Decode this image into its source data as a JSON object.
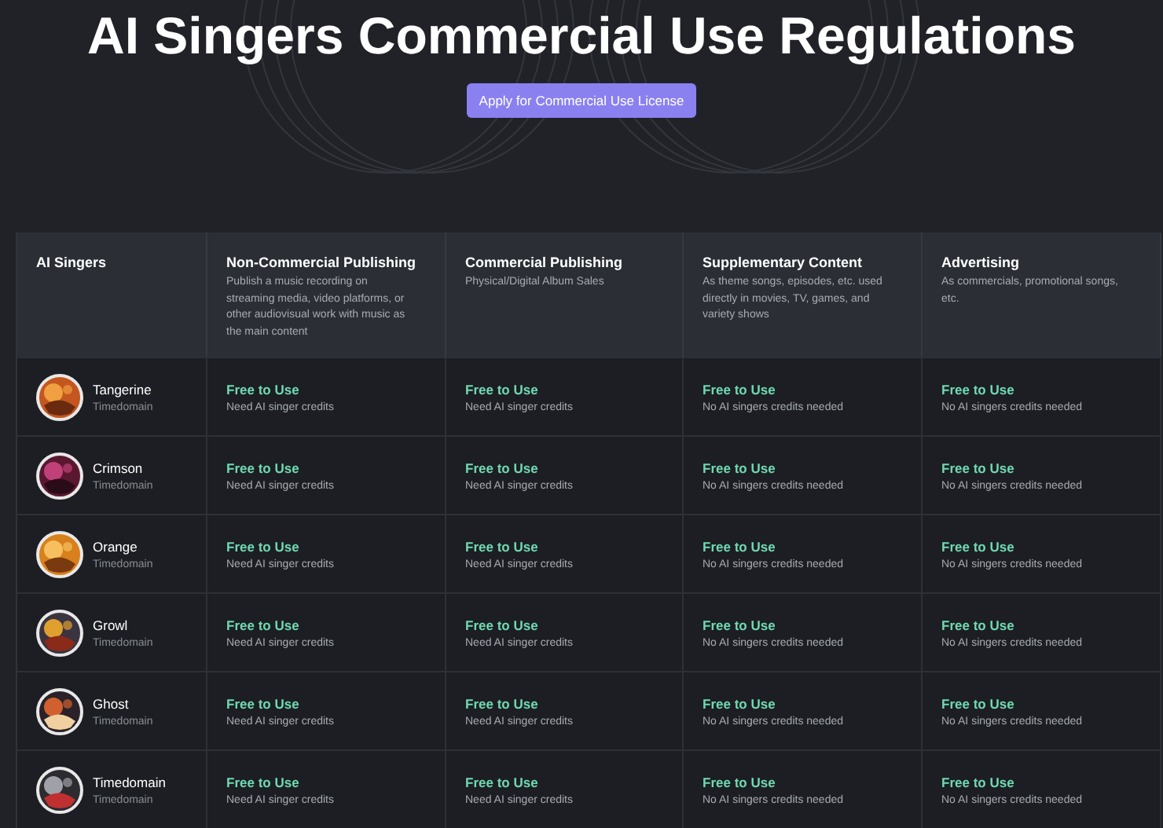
{
  "title": "AI Singers Commercial Use Regulations",
  "apply_button": "Apply for Commercial Use License",
  "table": {
    "columns": [
      {
        "title": "AI Singers"
      },
      {
        "title": "Non-Commercial Publishing",
        "description": "Publish a music recording on streaming media, video platforms, or other audiovisual work with music as the main content"
      },
      {
        "title": "Commercial Publishing",
        "description": "Physical/Digital Album Sales"
      },
      {
        "title": "Supplementary Content",
        "description": "As theme songs, episodes, etc. used directly in movies, TV, games, and variety shows"
      },
      {
        "title": "Advertising",
        "description": "As commercials, promotional songs, etc."
      }
    ],
    "rows": [
      {
        "cells": [
          {
            "name": "Tangerine",
            "maker": "Timedomain"
          },
          {
            "status": "Free to Use",
            "note": "Need AI singer credits"
          },
          {
            "status": "Free to Use",
            "note": "Need AI singer credits"
          },
          {
            "status": "Free to Use",
            "note": "No AI singers credits needed"
          },
          {
            "status": "Free to Use",
            "note": "No AI singers credits needed"
          }
        ]
      },
      {
        "cells": [
          {
            "name": "Crimson",
            "maker": "Timedomain"
          },
          {
            "status": "Free to Use",
            "note": "Need AI singer credits"
          },
          {
            "status": "Free to Use",
            "note": "Need AI singer credits"
          },
          {
            "status": "Free to Use",
            "note": "No AI singers credits needed"
          },
          {
            "status": "Free to Use",
            "note": "No AI singers credits needed"
          }
        ]
      },
      {
        "cells": [
          {
            "name": "Orange",
            "maker": "Timedomain"
          },
          {
            "status": "Free to Use",
            "note": "Need AI singer credits"
          },
          {
            "status": "Free to Use",
            "note": "Need AI singer credits"
          },
          {
            "status": "Free to Use",
            "note": "No AI singers credits needed"
          },
          {
            "status": "Free to Use",
            "note": "No AI singers credits needed"
          }
        ]
      },
      {
        "cells": [
          {
            "name": "Growl",
            "maker": "Timedomain"
          },
          {
            "status": "Free to Use",
            "note": "Need AI singer credits"
          },
          {
            "status": "Free to Use",
            "note": "Need AI singer credits"
          },
          {
            "status": "Free to Use",
            "note": "No AI singers credits needed"
          },
          {
            "status": "Free to Use",
            "note": "No AI singers credits needed"
          }
        ]
      },
      {
        "cells": [
          {
            "name": "Ghost",
            "maker": "Timedomain"
          },
          {
            "status": "Free to Use",
            "note": "Need AI singer credits"
          },
          {
            "status": "Free to Use",
            "note": "Need AI singer credits"
          },
          {
            "status": "Free to Use",
            "note": "No AI singers credits needed"
          },
          {
            "status": "Free to Use",
            "note": "No AI singers credits needed"
          }
        ]
      },
      {
        "cells": [
          {
            "name": "Timedomain",
            "maker": "Timedomain"
          },
          {
            "status": "Free to Use",
            "note": "Need AI singer credits"
          },
          {
            "status": "Free to Use",
            "note": "Need AI singer credits"
          },
          {
            "status": "Free to Use",
            "note": "No AI singers credits needed"
          },
          {
            "status": "Free to Use",
            "note": "No AI singers credits needed"
          }
        ]
      }
    ]
  }
}
